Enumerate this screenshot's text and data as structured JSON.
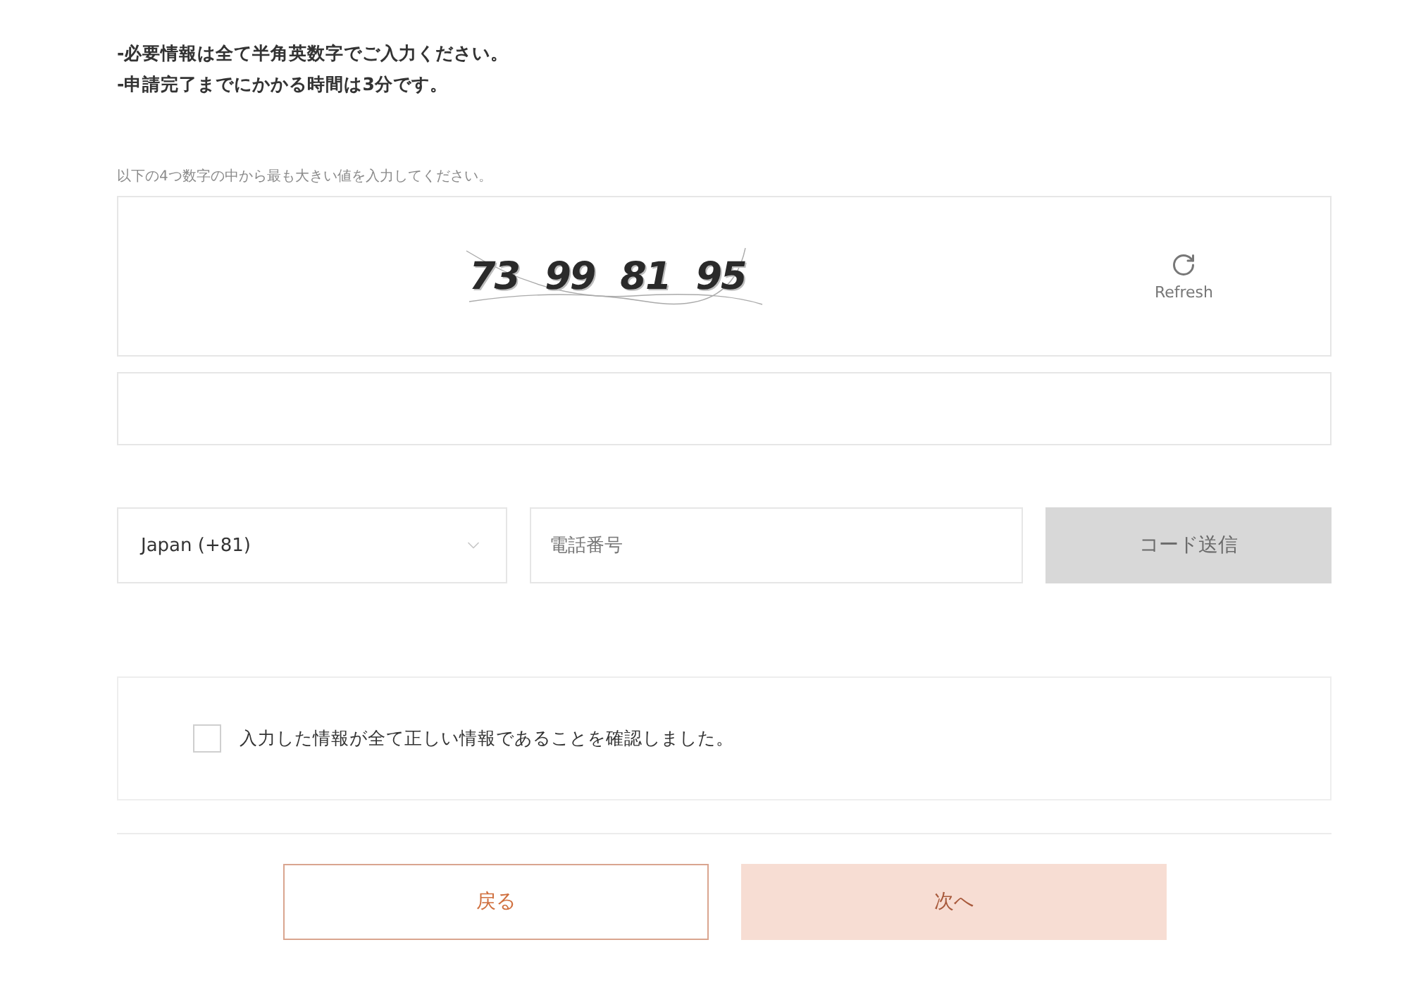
{
  "notes": [
    "-必要情報は全て半角英数字でご入力ください。",
    "-申請完了までにかかる時間は3分です。"
  ],
  "captcha": {
    "instruction": "以下の4つ数字の中から最も大きい値を入力してください。",
    "numbers": [
      "73",
      "99",
      "81",
      "95"
    ],
    "refresh_label": "Refresh"
  },
  "phone": {
    "country": "Japan (+81)",
    "placeholder": "電話番号",
    "send_button": {
      "label": "コード送信",
      "disabled": true
    }
  },
  "confirmation": {
    "label": "入力した情報が全て正しい情報であることを確認しました。",
    "checked": false
  },
  "buttons": [
    {
      "kind": "outline",
      "label": "戻る",
      "disabled": false
    },
    {
      "kind": "filled",
      "label": "次へ",
      "disabled": true
    }
  ]
}
